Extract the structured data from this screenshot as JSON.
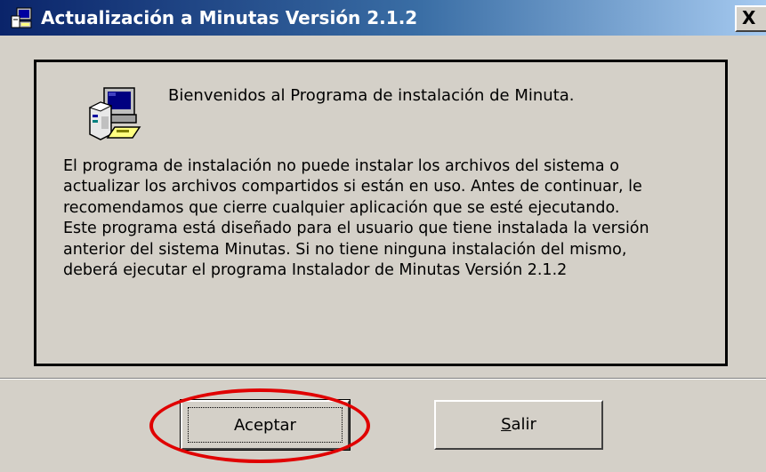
{
  "window": {
    "title": "Actualización a Minutas Versión 2.1.2",
    "close_label": "X"
  },
  "panel": {
    "welcome": "Bienvenidos al Programa de instalación de Minuta.",
    "body_lines": [
      "El programa de instalación no puede instalar los archivos del sistema o",
      "actualizar los archivos compartidos si están en uso. Antes de continuar, le",
      "recomendamos que cierre cualquier aplicación que se esté ejecutando.",
      "Este programa está diseñado para el usuario que tiene instalada la versión",
      "anterior del sistema Minutas. Si no tiene ninguna instalación del mismo,",
      "deberá ejecutar el programa Instalador de Minutas Versión 2.1.2"
    ]
  },
  "buttons": {
    "accept_label": "Aceptar",
    "exit_label": "Salir"
  },
  "icons": {
    "title_icon": "setup-program-icon",
    "panel_icon": "computer-setup-icon"
  },
  "colors": {
    "titlebar_start": "#0a246a",
    "titlebar_end": "#a6caf0",
    "window_face": "#d4d0c8",
    "highlight": "#e00000"
  }
}
